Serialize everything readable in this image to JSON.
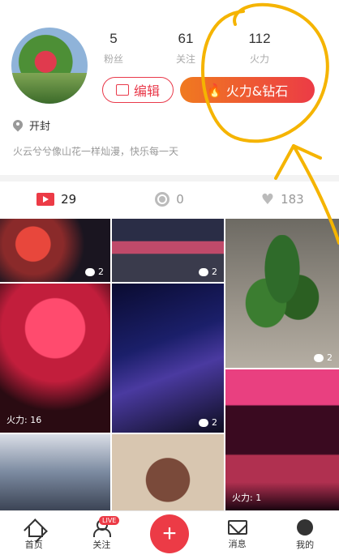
{
  "profile": {
    "stats": [
      {
        "value": "5",
        "label": "粉丝"
      },
      {
        "value": "61",
        "label": "关注"
      },
      {
        "value": "112",
        "label": "火力"
      }
    ],
    "edit_label": "编辑",
    "fire_label": "火力&钻石",
    "location": "开封",
    "bio": "火云兮兮像山花一样灿漫，快乐每一天"
  },
  "tabs": [
    {
      "icon": "video-icon",
      "count": "29"
    },
    {
      "icon": "camera-icon",
      "count": "0"
    },
    {
      "icon": "heart-icon",
      "count": "183"
    }
  ],
  "grid": {
    "items": [
      {
        "comments": "2"
      },
      {
        "comments": "2"
      },
      {
        "comments": "2"
      },
      {
        "fire": "火力: 16"
      },
      {
        "comments": "2"
      },
      {
        "fire": "火力: 1"
      }
    ]
  },
  "nav": {
    "home": "首页",
    "follow": "关注",
    "live_badge": "LIVE",
    "plus": "+",
    "messages": "消息",
    "me": "我的"
  },
  "colors": {
    "accent": "#ec3b46",
    "annotation": "#f5b400"
  }
}
